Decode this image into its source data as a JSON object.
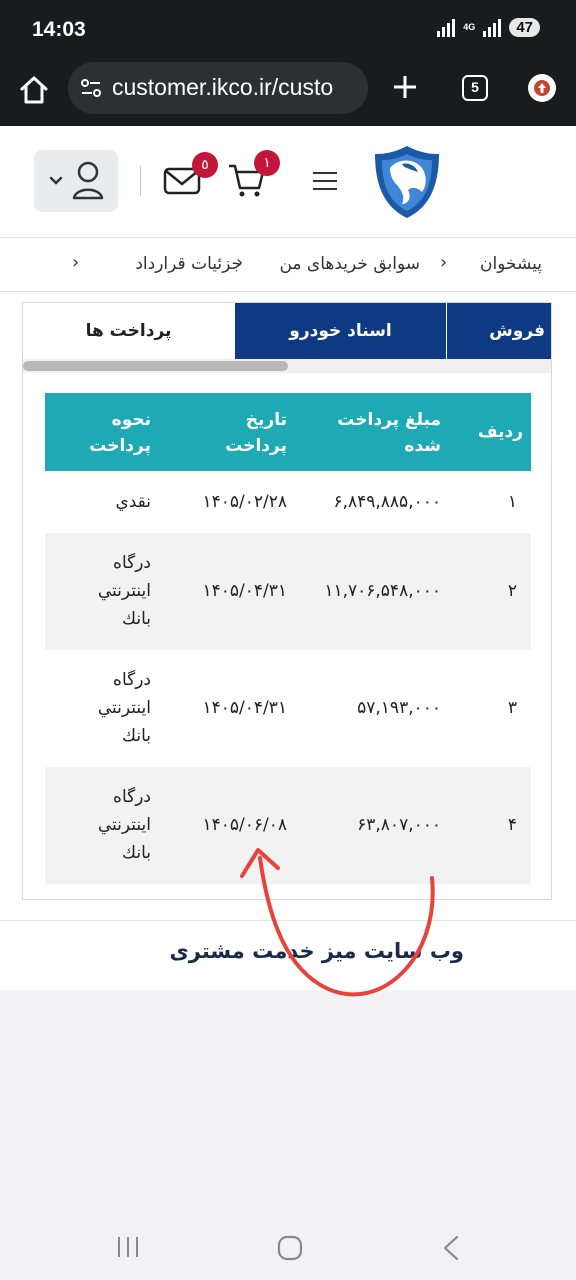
{
  "status": {
    "time": "14:03",
    "network": "4G",
    "battery": "47"
  },
  "browser": {
    "url": "customer.ikco.ir/custo",
    "tab_count": "5"
  },
  "header": {
    "mail_badge": "٥",
    "cart_badge": "١"
  },
  "breadcrumb": {
    "items": [
      "پیشخوان",
      "سوابق خریدهای من",
      "جزئیات قرارداد"
    ]
  },
  "tabs": [
    {
      "label": "پرداخت ها",
      "active": true
    },
    {
      "label": "اسناد خودرو",
      "active": false
    },
    {
      "label": "فروش",
      "active": false
    }
  ],
  "table": {
    "headers": {
      "row_no": "ردیف",
      "amount_l1": "مبلغ پرداخت",
      "amount_l2": "شده",
      "date_l1": "تاریخ",
      "date_l2": "پرداخت",
      "method_l1": "نحوه",
      "method_l2": "پرداخت"
    },
    "rows": [
      {
        "no": "١",
        "amount": "۶,۸۴۹,۸۸۵,۰۰۰",
        "date": "۱۴۰۵/۰۲/۲۸",
        "method": [
          "نقدي"
        ]
      },
      {
        "no": "٢",
        "amount": "۱۱,۷۰۶,۵۴۸,۰۰۰",
        "date": "۱۴۰۵/۰۴/۳۱",
        "method": [
          "درگاه",
          "اینترنتي",
          "بانك"
        ]
      },
      {
        "no": "٣",
        "amount": "۵۷,۱۹۳,۰۰۰",
        "date": "۱۴۰۵/۰۴/۳۱",
        "method": [
          "درگاه",
          "اینترنتي",
          "بانك"
        ]
      },
      {
        "no": "۴",
        "amount": "۶۳,۸۰۷,۰۰۰",
        "date": "۱۴۰۵/۰۶/۰۸",
        "method": [
          "درگاه",
          "اینترنتي",
          "بانك"
        ]
      }
    ]
  },
  "footer": {
    "text": "وب سایت میز خدمت مشتری"
  },
  "colors": {
    "tab_active_bg": "#0d3a82",
    "table_header_bg": "#1fa9b5",
    "badge": "#c4163b",
    "annotation": "#e8433a"
  }
}
